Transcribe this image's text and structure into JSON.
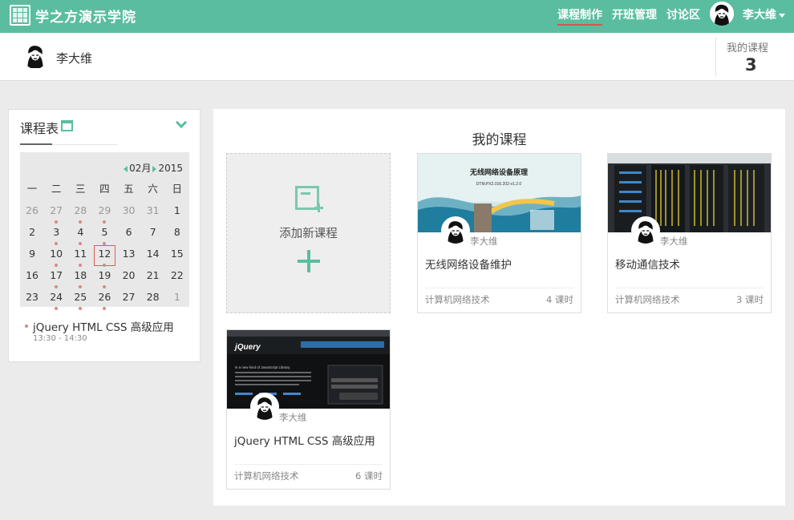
{
  "brand": {
    "name": "学之方演示学院"
  },
  "nav": {
    "items": [
      {
        "label": "课程制作",
        "active": true
      },
      {
        "label": "开班管理",
        "active": false
      },
      {
        "label": "讨论区",
        "active": false
      }
    ],
    "user": "李大维"
  },
  "profile": {
    "name": "李大维",
    "stat_label": "我的课程",
    "stat_value": "3"
  },
  "schedule": {
    "title": "课程表",
    "month": "02月",
    "year": "2015",
    "weekdays": [
      "一",
      "二",
      "三",
      "四",
      "五",
      "六",
      "日"
    ],
    "days": [
      {
        "d": "26",
        "muted": true
      },
      {
        "d": "27",
        "muted": true,
        "event": true
      },
      {
        "d": "28",
        "muted": true,
        "event": true
      },
      {
        "d": "29",
        "muted": true,
        "event": true
      },
      {
        "d": "30",
        "muted": true
      },
      {
        "d": "31",
        "muted": true
      },
      {
        "d": "1"
      },
      {
        "d": "2"
      },
      {
        "d": "3",
        "event": true
      },
      {
        "d": "4",
        "event": true
      },
      {
        "d": "5",
        "event": true
      },
      {
        "d": "6"
      },
      {
        "d": "7"
      },
      {
        "d": "8"
      },
      {
        "d": "9"
      },
      {
        "d": "10",
        "event": true
      },
      {
        "d": "11",
        "event": true
      },
      {
        "d": "12",
        "today": true,
        "event": true
      },
      {
        "d": "13"
      },
      {
        "d": "14"
      },
      {
        "d": "15"
      },
      {
        "d": "16"
      },
      {
        "d": "17",
        "event": true
      },
      {
        "d": "18",
        "event": true
      },
      {
        "d": "19",
        "event": true
      },
      {
        "d": "20"
      },
      {
        "d": "21"
      },
      {
        "d": "22"
      },
      {
        "d": "23"
      },
      {
        "d": "24",
        "event": true
      },
      {
        "d": "25",
        "event": true
      },
      {
        "d": "26",
        "event": true
      },
      {
        "d": "27"
      },
      {
        "d": "28"
      },
      {
        "d": "1",
        "muted": true
      }
    ],
    "event": {
      "title": "jQuery HTML CSS 高级应用",
      "time": "13:30 - 14:30"
    }
  },
  "courses": {
    "title": "我的课程",
    "add_label": "添加新课程",
    "items": [
      {
        "title": "无线网络设备维护",
        "author": "李大维",
        "category": "计算机网络技术",
        "hours": "4 课时",
        "thumb_heading": "无线网络设备原理",
        "thumb_sub": "DTM.PX2.016.202-v1.2.0"
      },
      {
        "title": "移动通信技术",
        "author": "李大维",
        "category": "计算机网络技术",
        "hours": "3 课时"
      },
      {
        "title": "jQuery HTML CSS 高级应用",
        "author": "李大维",
        "category": "计算机网络技术",
        "hours": "6 课时",
        "thumb_logo": "jQuery",
        "thumb_tagline": "is a new kind of JavaScript Library."
      }
    ]
  },
  "colors": {
    "brand": "#5bbda0",
    "accent_red": "#e05a4f"
  }
}
